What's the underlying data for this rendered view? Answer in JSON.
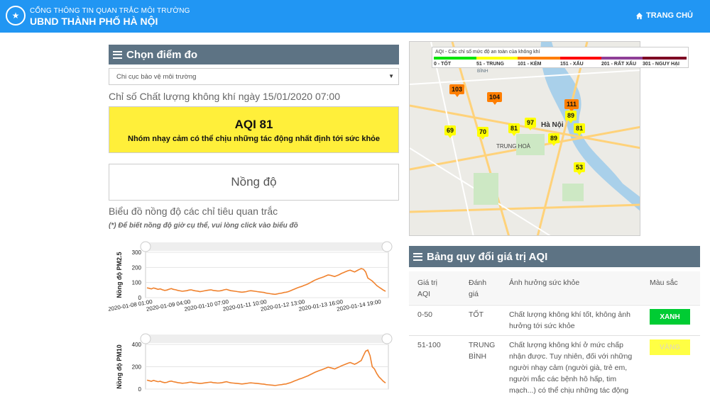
{
  "header": {
    "line1": "CỔNG THÔNG TIN QUAN TRẮC MÔI TRƯỜNG",
    "line2": "UBND THÀNH PHỐ HÀ NỘI",
    "home_label": "TRANG CHỦ"
  },
  "station": {
    "section_title": "Chọn điểm đo",
    "selected": "Chi cục bảo vệ môi trường"
  },
  "aqi": {
    "date_label": "Chỉ số Chất lượng không khí ngày 15/01/2020 07:00",
    "value_label": "AQI 81",
    "description": "Nhóm nhạy cảm có thể chịu những tác động nhất định tới sức khỏe",
    "color": "#ffef3a"
  },
  "concentration": {
    "title": "Nồng độ",
    "chart_title": "Biểu đồ nồng độ các chỉ tiêu quan trắc",
    "note": "(*) Để biết nồng độ giờ cụ thể, vui lòng click vào biểu đồ"
  },
  "chart_data": [
    {
      "type": "line",
      "ylabel": "Nồng độ PM2.5",
      "ylim": [
        0,
        300
      ],
      "yticks": [
        0,
        100,
        200,
        300
      ],
      "xticks": [
        "2020-01-08 01:00",
        "2020-01-09 04:00",
        "2020-01-10 07:00",
        "2020-01-11 10:00",
        "2020-01-12 13:00",
        "2020-01-13 16:00",
        "2020-01-14 19:00"
      ],
      "values": [
        65,
        62,
        58,
        64,
        60,
        55,
        58,
        52,
        48,
        50,
        56,
        60,
        55,
        52,
        48,
        45,
        42,
        44,
        46,
        50,
        52,
        48,
        45,
        43,
        40,
        42,
        45,
        48,
        50,
        52,
        48,
        46,
        44,
        45,
        48,
        52,
        55,
        50,
        46,
        44,
        42,
        40,
        38,
        36,
        38,
        40,
        44,
        46,
        44,
        42,
        40,
        38,
        36,
        34,
        30,
        28,
        26,
        24,
        22,
        25,
        28,
        30,
        34,
        36,
        40,
        46,
        52,
        58,
        64,
        70,
        74,
        80,
        86,
        92,
        100,
        108,
        116,
        122,
        128,
        132,
        138,
        144,
        150,
        148,
        144,
        140,
        146,
        152,
        160,
        166,
        172,
        178,
        182,
        176,
        170,
        178,
        186,
        192,
        188,
        170,
        130,
        120,
        110,
        96,
        80,
        70,
        60,
        50,
        42
      ]
    },
    {
      "type": "line",
      "ylabel": "Nồng độ PM10",
      "ylim": [
        0,
        400
      ],
      "yticks": [
        0,
        200,
        400
      ],
      "values": [
        80,
        75,
        70,
        78,
        72,
        66,
        70,
        62,
        58,
        60,
        68,
        72,
        66,
        62,
        58,
        55,
        52,
        54,
        56,
        60,
        62,
        58,
        55,
        53,
        50,
        52,
        55,
        58,
        60,
        62,
        58,
        56,
        54,
        55,
        58,
        62,
        66,
        60,
        56,
        54,
        52,
        50,
        48,
        46,
        48,
        50,
        54,
        56,
        54,
        52,
        50,
        48,
        46,
        44,
        40,
        38,
        36,
        34,
        32,
        35,
        38,
        40,
        44,
        46,
        52,
        58,
        66,
        74,
        82,
        90,
        96,
        104,
        112,
        120,
        130,
        140,
        150,
        158,
        166,
        172,
        180,
        188,
        196,
        192,
        186,
        180,
        190,
        198,
        208,
        216,
        224,
        232,
        238,
        230,
        222,
        232,
        244,
        256,
        300,
        340,
        350,
        300,
        200,
        180,
        140,
        110,
        90,
        70,
        55
      ]
    }
  ],
  "map": {
    "legend_title": "AQI - Các chỉ số mức độ an toàn của không khí",
    "levels": [
      {
        "label": "0 - TỐT",
        "color": "#00e400"
      },
      {
        "label": "51 - TRUNG",
        "color": "#ffff00"
      },
      {
        "label": "101 - KÉM",
        "color": "#ff7e00"
      },
      {
        "label": "151 - XẤU",
        "color": "#ff0000"
      },
      {
        "label": "201 - RẤT XẤU",
        "color": "#8f3f97"
      },
      {
        "label": "301 - NGUY HẠI",
        "color": "#7e0023"
      }
    ],
    "markers": [
      {
        "value": "103",
        "color": "#ff7e00"
      },
      {
        "value": "104",
        "color": "#ff7e00"
      },
      {
        "value": "111",
        "color": "#ff7e00"
      },
      {
        "value": "89",
        "color": "#ffff00"
      },
      {
        "value": "97",
        "color": "#ffff00"
      },
      {
        "value": "81",
        "color": "#ffff00"
      },
      {
        "value": "81",
        "color": "#ffff00"
      },
      {
        "value": "69",
        "color": "#ffff00"
      },
      {
        "value": "70",
        "color": "#ffff00"
      },
      {
        "value": "89",
        "color": "#ffff00"
      },
      {
        "value": "53",
        "color": "#ffff00"
      }
    ],
    "places": {
      "hanoi": "Hà Nội",
      "trunghoa": "TRUNG HOÀ",
      "binh": "BÌNH"
    }
  },
  "aqi_table": {
    "section_title": "Bảng quy đổi giá trị AQI",
    "headers": [
      "Giá trị AQI",
      "Đánh giá",
      "Ảnh hưởng sức khỏe",
      "Màu sắc"
    ],
    "rows": [
      {
        "range": "0-50",
        "rating": "TỐT",
        "effect": "Chất lượng không khí tốt, không ảnh hưởng tới sức khỏe",
        "color_label": "XANH",
        "color": "#00cc33"
      },
      {
        "range": "51-100",
        "rating": "TRUNG BÌNH",
        "effect": "Chất lượng không khí ở mức chấp nhận được. Tuy nhiên, đối với những người nhạy cảm (người già, trẻ em, người mắc các bệnh hô hấp, tim mạch...) có thể chịu những tác động",
        "color_label": "VÀNG",
        "color": "#ffff44"
      }
    ]
  }
}
